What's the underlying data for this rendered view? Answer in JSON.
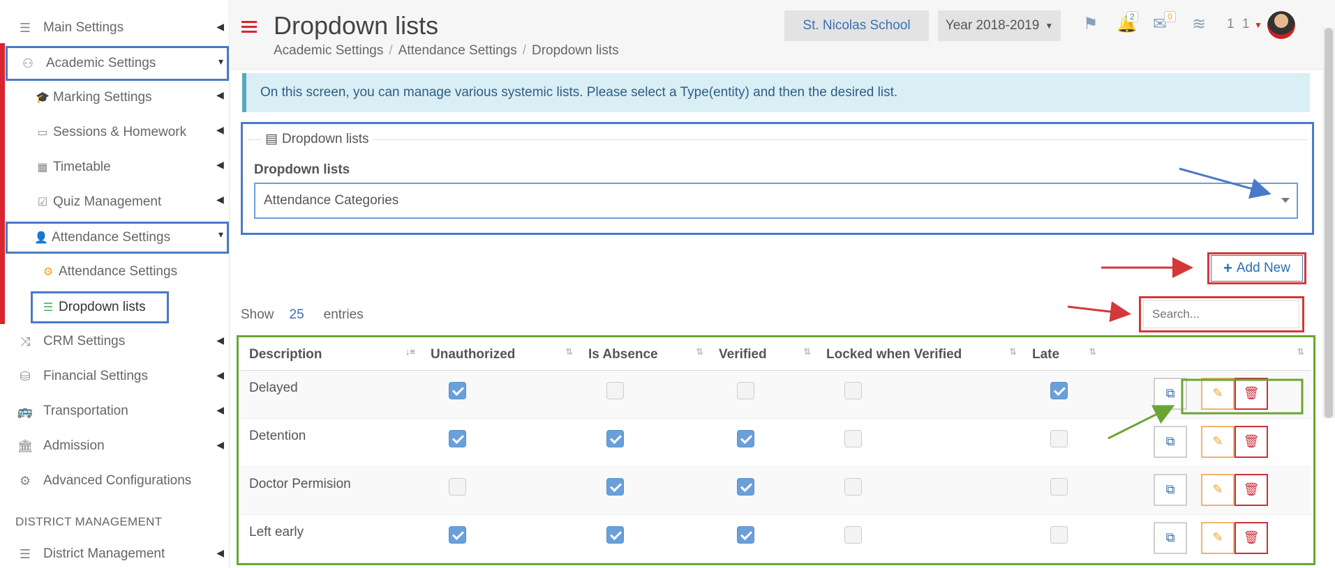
{
  "sidebar": {
    "items": [
      {
        "label": "Main Settings",
        "icon": "sliders-icon"
      },
      {
        "label": "Academic Settings",
        "icon": "group-icon"
      },
      {
        "label": "Marking Settings",
        "icon": "graduation-cap-icon"
      },
      {
        "label": "Sessions & Homework",
        "icon": "teacher-board-icon"
      },
      {
        "label": "Timetable",
        "icon": "calendar-icon"
      },
      {
        "label": "Quiz Management",
        "icon": "checkbox-icon"
      },
      {
        "label": "Attendance Settings",
        "icon": "user-x-icon"
      },
      {
        "label": "Attendance Settings",
        "icon": "gear-icon"
      },
      {
        "label": "Dropdown lists",
        "icon": "list-icon"
      },
      {
        "label": "CRM Settings",
        "icon": "shuffle-icon"
      },
      {
        "label": "Financial Settings",
        "icon": "coins-icon"
      },
      {
        "label": "Transportation",
        "icon": "bus-icon"
      },
      {
        "label": "Admission",
        "icon": "institution-icon"
      },
      {
        "label": "Advanced Configurations",
        "icon": "gears-icon"
      }
    ],
    "district_heading": "DISTRICT MANAGEMENT",
    "district_item": {
      "label": "District Management",
      "icon": "menu-icon"
    }
  },
  "header": {
    "title": "Dropdown lists",
    "breadcrumb": [
      "Academic Settings",
      "Attendance Settings",
      "Dropdown lists"
    ],
    "school": "St. Nicolas School",
    "year": "Year 2018-2019",
    "notifications_count": "2",
    "messages_count": "0",
    "user_count": "1 1"
  },
  "info": "On this screen, you can manage various systemic lists. Please select a Type(entity) and then the desired list.",
  "panel": {
    "title": "Dropdown lists",
    "field_label": "Dropdown lists",
    "selected": "Attendance Categories"
  },
  "add_new_label": "Add New",
  "search_placeholder": "Search...",
  "show_entries": {
    "prefix": "Show",
    "value": "25",
    "suffix": "entries"
  },
  "table": {
    "columns": [
      "Description",
      "Unauthorized",
      "Is Absence",
      "Verified",
      "Locked when Verified",
      "Late"
    ],
    "rows": [
      {
        "description": "Delayed",
        "unauthorized": true,
        "is_absence": false,
        "verified": false,
        "locked": false,
        "late": true
      },
      {
        "description": "Detention",
        "unauthorized": true,
        "is_absence": true,
        "verified": true,
        "locked": false,
        "late": false
      },
      {
        "description": "Doctor Permision",
        "unauthorized": false,
        "is_absence": true,
        "verified": true,
        "locked": false,
        "late": false
      },
      {
        "description": "Left early",
        "unauthorized": true,
        "is_absence": true,
        "verified": true,
        "locked": false,
        "late": false
      }
    ]
  },
  "colors": {
    "accent_red": "#d9252f",
    "blue": "#4a79c7",
    "checkbox_on": "#6aa0d9",
    "annotation_green": "#6aa534"
  }
}
